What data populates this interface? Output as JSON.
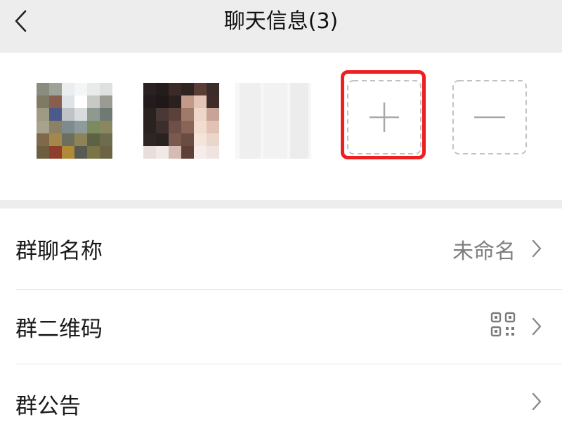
{
  "header": {
    "back_icon": "chevron-left-icon",
    "title": "聊天信息(3)"
  },
  "members": {
    "add_icon": "plus-icon",
    "remove_icon": "minus-icon",
    "highlight_color": "#ee1f1f"
  },
  "settings": {
    "group_name": {
      "label": "群聊名称",
      "value": "未命名"
    },
    "group_qr": {
      "label": "群二维码",
      "icon": "qr-code-icon"
    },
    "group_notice": {
      "label": "群公告"
    }
  }
}
